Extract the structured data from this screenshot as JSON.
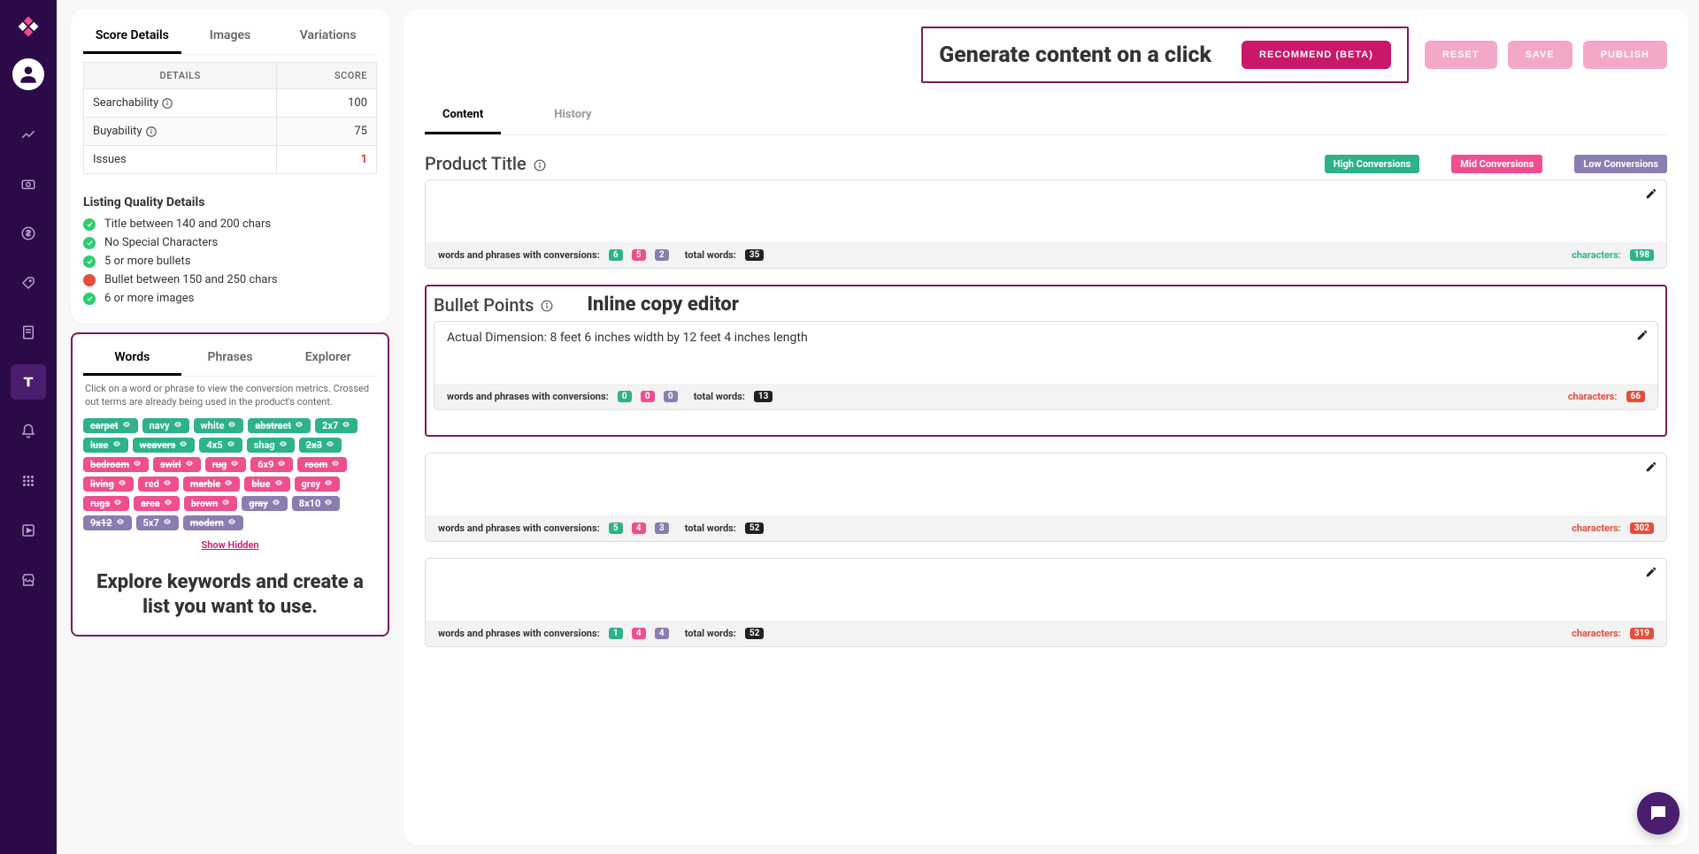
{
  "tabs": {
    "score": "Score Details",
    "images": "Images",
    "variations": "Variations"
  },
  "score_table": {
    "headers": {
      "details": "Details",
      "score": "Score"
    },
    "rows": [
      {
        "label": "Searchability",
        "value": "100",
        "red": false,
        "info": true
      },
      {
        "label": "Buyability",
        "value": "75",
        "red": false,
        "info": true
      },
      {
        "label": "Issues",
        "value": "1",
        "red": true,
        "info": false
      }
    ]
  },
  "lq": {
    "title": "Listing Quality Details",
    "items": [
      {
        "text": "Title between 140 and 200 chars",
        "ok": true
      },
      {
        "text": "No Special Characters",
        "ok": true
      },
      {
        "text": "5 or more bullets",
        "ok": true
      },
      {
        "text": "Bullet between 150 and 250 chars",
        "ok": false
      },
      {
        "text": "6 or more images",
        "ok": true
      }
    ]
  },
  "words": {
    "tabs": {
      "words": "Words",
      "phrases": "Phrases",
      "explorer": "Explorer"
    },
    "hint": "Click on a word or phrase to view the conversion metrics. Crossed out terms are already being used in the product's content.",
    "chips": [
      {
        "label": "carpet",
        "color": "green",
        "strike": true
      },
      {
        "label": "navy",
        "color": "green",
        "strike": false
      },
      {
        "label": "white",
        "color": "green",
        "strike": false
      },
      {
        "label": "abstract",
        "color": "green",
        "strike": true
      },
      {
        "label": "2x7",
        "color": "green",
        "strike": false
      },
      {
        "label": "luxe",
        "color": "green",
        "strike": true
      },
      {
        "label": "weavers",
        "color": "green",
        "strike": true
      },
      {
        "label": "4x5",
        "color": "green",
        "strike": false
      },
      {
        "label": "shag",
        "color": "green",
        "strike": false
      },
      {
        "label": "2x3",
        "color": "green",
        "strike": true
      },
      {
        "label": "bedroom",
        "color": "pink",
        "strike": true
      },
      {
        "label": "swirl",
        "color": "pink",
        "strike": true
      },
      {
        "label": "rug",
        "color": "pink",
        "strike": true
      },
      {
        "label": "6x9",
        "color": "pink",
        "strike": false
      },
      {
        "label": "room",
        "color": "pink",
        "strike": true
      },
      {
        "label": "living",
        "color": "pink",
        "strike": true
      },
      {
        "label": "red",
        "color": "pink",
        "strike": false
      },
      {
        "label": "marble",
        "color": "pink",
        "strike": true
      },
      {
        "label": "blue",
        "color": "pink",
        "strike": true
      },
      {
        "label": "grey",
        "color": "pink",
        "strike": false
      },
      {
        "label": "rugs",
        "color": "pink",
        "strike": true
      },
      {
        "label": "area",
        "color": "pink",
        "strike": true
      },
      {
        "label": "brown",
        "color": "pink",
        "strike": true
      },
      {
        "label": "gray",
        "color": "purple",
        "strike": true
      },
      {
        "label": "8x10",
        "color": "purple",
        "strike": false
      },
      {
        "label": "9x12",
        "color": "purple",
        "strike": true
      },
      {
        "label": "5x7",
        "color": "purple",
        "strike": false
      },
      {
        "label": "modern",
        "color": "purple",
        "strike": true
      }
    ],
    "show_hidden": "Show Hidden",
    "explore_caption": "Explore keywords and create a list you want to use."
  },
  "right": {
    "gen_text": "Generate content on a click",
    "buttons": {
      "recommend": "Recommend (Beta)",
      "reset": "Reset",
      "save": "Save",
      "publish": "Publish"
    },
    "ctabs": {
      "content": "Content",
      "history": "History"
    },
    "pt_title": "Product Title",
    "badges": {
      "hi": "High Conversions",
      "mid": "Mid Conversions",
      "low": "Low Conversions"
    },
    "bp_title": "Bullet Points",
    "inline_label": "Inline copy editor",
    "stats_label_conv": "words and phrases with conversions:",
    "stats_label_total": "total words:",
    "stats_label_chars": "characters:",
    "blocks": [
      {
        "text": "",
        "conv": [
          "6",
          "5",
          "2"
        ],
        "total": "35",
        "chars": "198",
        "chars_ok": true
      },
      {
        "text": "Actual Dimension: 8 feet 6 inches width by 12 feet 4 inches length",
        "conv": [
          "0",
          "0",
          "0"
        ],
        "total": "13",
        "chars": "66",
        "chars_ok": false
      },
      {
        "text": "",
        "conv": [
          "5",
          "4",
          "3"
        ],
        "total": "52",
        "chars": "302",
        "chars_ok": false
      },
      {
        "text": "",
        "conv": [
          "1",
          "4",
          "4"
        ],
        "total": "52",
        "chars": "319",
        "chars_ok": false
      }
    ]
  }
}
